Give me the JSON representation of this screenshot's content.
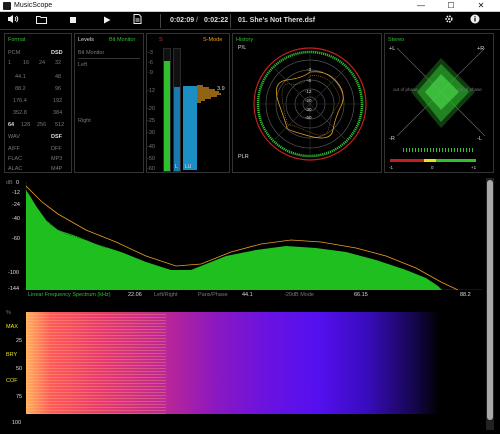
{
  "app": {
    "title": "MusicScope",
    "icon": "musicscope-logo-icon"
  },
  "window_controls": {
    "minimize": "—",
    "maximize": "☐",
    "close": "✕"
  },
  "toolbar": {
    "volume_icon": "speaker-icon",
    "open_icon": "folder-icon",
    "stop_icon": "stop-icon",
    "play_icon": "play-icon",
    "export_icon": "document-icon",
    "time_elapsed": "0:02:09",
    "time_sep": "/",
    "time_total": "0:02:22",
    "track": "01. She's Not There.dsf",
    "settings_icon": "gear-icon",
    "info_icon": "info-icon"
  },
  "format": {
    "heading": "Format",
    "pcm_label": "PCM",
    "dsd_label": "DSD",
    "bits": [
      "1",
      "16",
      "24",
      "32"
    ],
    "pcm_rates": [
      "44.1",
      "88.2",
      "176.4",
      "352.8"
    ],
    "dsd_rates": [
      "48",
      "96",
      "192",
      "384"
    ],
    "dsd_mult": [
      "64",
      "128",
      "256",
      "512"
    ],
    "wav": "WAV",
    "dsf": "DSF",
    "aiff": "AIFF",
    "dff": "DFF",
    "flac": "FLAC",
    "mp3": "MP3",
    "alac": "ALAC",
    "mp4": "M4P"
  },
  "levels": {
    "heading": "Levels",
    "sub": "Bit Monitor",
    "bit_monitor": "Bit Monitor",
    "left": "Left",
    "right": "Right"
  },
  "meter": {
    "s_label": "S",
    "s_mode": "S-Mode",
    "scale": [
      "-3",
      "-6",
      "-9",
      "-12",
      "-20",
      "-25",
      "-30",
      "-40",
      "-50",
      "-60"
    ],
    "peak_value": "3.9",
    "ch_l": "L",
    "ch_r": "LU"
  },
  "history": {
    "heading": "History",
    "pl_label": "P/L",
    "plr_label": "PLR",
    "rings": [
      "-3",
      "-6",
      "-12",
      "-20",
      "-30",
      "-60"
    ]
  },
  "stereo": {
    "heading": "Stereo",
    "l_plus": "+L",
    "r_plus": "+R",
    "l_minus": "-L",
    "r_minus": "-R",
    "out_phase_left": "out of phase",
    "out_phase_right": "out of phase",
    "corr_scale": [
      "-1",
      "0",
      "+1"
    ]
  },
  "spectrum": {
    "db_label": "dB",
    "y_ticks": [
      "0",
      "-12",
      "-24",
      "-40",
      "-60",
      "-100",
      "-144"
    ],
    "x_ticks": [
      "22.06",
      "44.1",
      "66.15",
      "88.2"
    ],
    "footer": [
      "Linear Frequency Spectrum (kHz)",
      "Left/Right",
      "Pans/Phase",
      "-20dB Mode"
    ]
  },
  "spectrogram": {
    "pct_label": "%",
    "y_ticks": [
      "25",
      "50",
      "75",
      "100"
    ],
    "side": [
      "MAX",
      "BRY",
      "COF"
    ]
  },
  "colors": {
    "green": "#2fbf2f",
    "orange": "#e8a020",
    "red": "#e03030"
  }
}
